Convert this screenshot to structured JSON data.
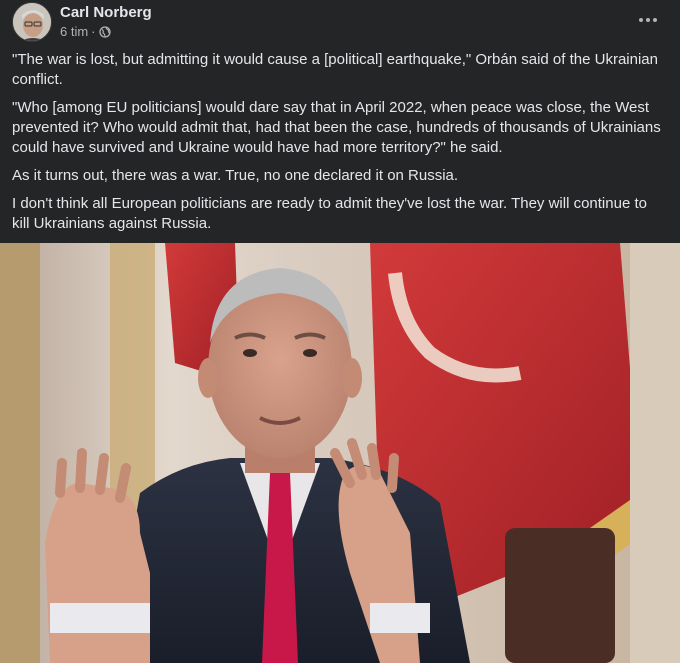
{
  "post": {
    "author": "Carl Norberg",
    "time": "6 tim",
    "separator": "·",
    "audience_icon": "globe-icon",
    "more_icon": "more-options-icon",
    "paragraphs": [
      "\"The war is lost, but admitting it would cause a [political] earthquake,\" Orbán said of the Ukrainian conflict.",
      "\"Who [among EU politicians] would dare say that in April 2022, when peace was close, the West prevented it? Who would admit that, had that been the case, hundreds of thousands of Ukrainians could have survived and Ukraine would have had more territory?\" he said.",
      "As it turns out, there was a war. True, no one declared it on Russia.",
      "I don't think all European politicians are ready to admit they've lost the war. They will continue to kill Ukrainians against Russia."
    ]
  },
  "colors": {
    "background": "#242526",
    "primary_text": "#e4e6eb",
    "secondary_text": "#b0b3b8"
  }
}
